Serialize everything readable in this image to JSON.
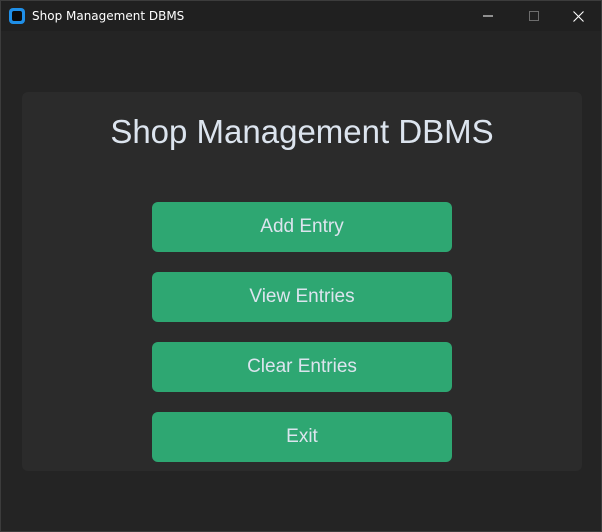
{
  "window": {
    "title": "Shop Management DBMS",
    "icon": "app-window-icon",
    "controls": [
      "minimize",
      "maximize",
      "close"
    ]
  },
  "main": {
    "heading": "Shop Management DBMS",
    "buttons": [
      {
        "label": "Add Entry"
      },
      {
        "label": "View Entries"
      },
      {
        "label": "Clear Entries"
      },
      {
        "label": "Exit"
      }
    ]
  },
  "colors": {
    "background": "#242424",
    "panel": "#2b2b2b",
    "button": "#2ea772",
    "text": "#dce4ee"
  }
}
